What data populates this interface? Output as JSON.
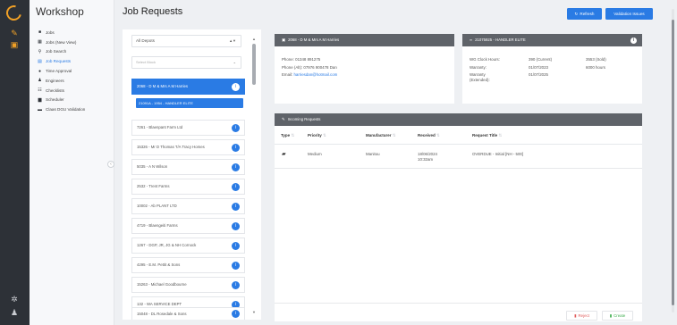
{
  "sidebar": {
    "app_name": "Workshop",
    "items": [
      {
        "label": "Jobs",
        "icon": "briefcase-icon",
        "glyph": "■"
      },
      {
        "label": "Jobs (New View)",
        "icon": "calendar-icon",
        "glyph": "▦"
      },
      {
        "label": "Job Search",
        "icon": "search-icon",
        "glyph": "⚲"
      },
      {
        "label": "Job Requests",
        "icon": "list-icon",
        "glyph": "▤",
        "active": true
      },
      {
        "label": "Time Approval",
        "icon": "clock-icon",
        "glyph": "●"
      },
      {
        "label": "Engineers",
        "icon": "users-icon",
        "glyph": "♟"
      },
      {
        "label": "Checklists",
        "icon": "checklist-icon",
        "glyph": "☷"
      },
      {
        "label": "Scheduler",
        "icon": "scheduler-icon",
        "glyph": "▆"
      },
      {
        "label": "Claas DGU Validation",
        "icon": "folder-icon",
        "glyph": "▬"
      }
    ]
  },
  "header": {
    "title": "Job Requests",
    "refresh_label": "Refresh",
    "validation_label": "Validation Issues"
  },
  "list": {
    "depot_select": "All Depots",
    "secondary_select_placeholder": "Select Block",
    "selected_job": "2068 - D M & Mrs A M Harries",
    "selected_tag": "21091A - 1954 - HANDLER ELITE",
    "jobs": [
      "7261 - Blaenpant Farm Ltd",
      "15326 - Mr D Thomas T/A Tracy Homes",
      "5035 - A N Wilson",
      "2532 - Trent Farms",
      "10002 - Ab PLANT LTD",
      "4719 - Blaengeiti Farms",
      "1267 - DGP, JR, JG & NH Cornock",
      "4295 - E.M. Pettit & Sons",
      "15263 - Michael Goodbourne",
      "132 - WA SERVICE DEPT",
      "15048 - DL Rosedale & Sons"
    ]
  },
  "customer": {
    "header": "2068 - D M & Mrs A M Harries",
    "phone": "Phone: 01348 891275",
    "phone_alt": "Phone (Alt): 07976 900478 Dan",
    "email_label": "Email:",
    "email": "harriesdan@hotmail.com"
  },
  "machine": {
    "header": "21075925 - HANDLER ELITE",
    "rows": [
      {
        "label": "WG Clock Hours:",
        "value": "390 (Current)",
        "extra": "3553 (Sold)"
      },
      {
        "label": "Warranty:",
        "value": "01/07/2023",
        "extra": "6000 hours"
      },
      {
        "label": "Warranty (Extended):",
        "value": "01/07/2025",
        "extra": ""
      }
    ]
  },
  "incoming": {
    "header": "Incoming Requests",
    "columns": [
      "Type",
      "Priority",
      "Manufacturer",
      "Received",
      "Request Title"
    ],
    "rows": [
      {
        "priority": "Medium",
        "manufacturer": "Manitou",
        "received_date": "18/06/2024",
        "received_time": "10:32am",
        "title": "OVERDUE - Initial [NH - 500]"
      }
    ],
    "reject_label": "Reject",
    "create_label": "Create"
  },
  "colors": {
    "accent": "#2a7be4",
    "rail": "#2d3137",
    "brand": "#f0a026",
    "card_header": "#5f6369"
  }
}
